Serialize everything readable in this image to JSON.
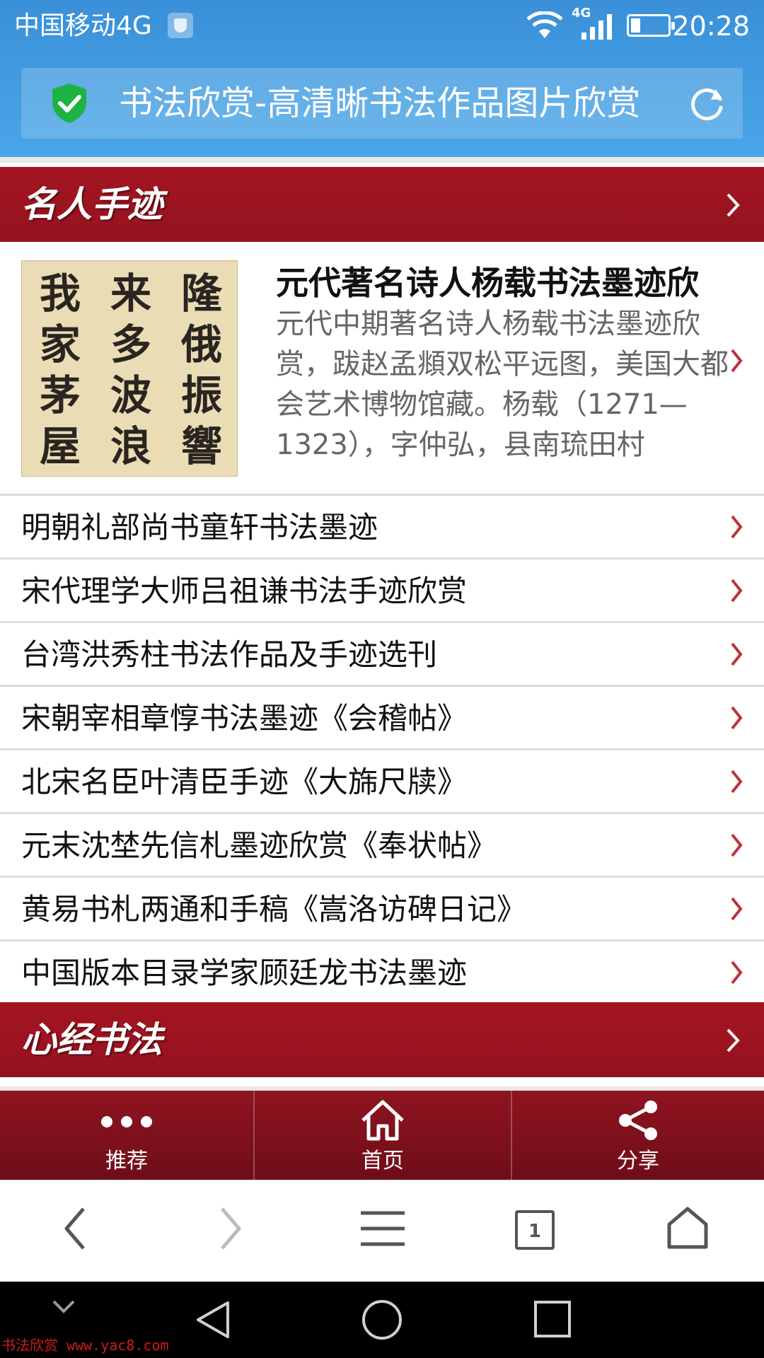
{
  "status_bar": {
    "carrier": "中国移动4G",
    "network_type": "4G",
    "time": "20:28",
    "battery_level": 0.25
  },
  "address_bar": {
    "title": "书法欣赏-高清晰书法作品图片欣赏"
  },
  "sections": [
    {
      "title": "名人手迹"
    },
    {
      "title": "心经书法"
    }
  ],
  "featured": {
    "title": "元代著名诗人杨载书法墨迹欣",
    "description": "元代中期著名诗人杨载书法墨迹欣赏，跋赵孟頫双松平远图，美国大都会艺术博物馆藏。杨载（1271—1323），字仲弘，县南琉田村",
    "thumbnail_columns": [
      "隆俄振響",
      "来多波浪",
      "我家茅屋"
    ]
  },
  "articles": [
    {
      "label": "明朝礼部尚书童轩书法墨迹"
    },
    {
      "label": "宋代理学大师吕祖谦书法手迹欣赏"
    },
    {
      "label": "台湾洪秀柱书法作品及手迹选刊"
    },
    {
      "label": "宋朝宰相章惇书法墨迹《会稽帖》"
    },
    {
      "label": "北宋名臣叶清臣手迹《大旆尺牍》"
    },
    {
      "label": "元末沈埜先信札墨迹欣赏《奉状帖》"
    },
    {
      "label": "黄易书札两通和手稿《嵩洛访碑日记》"
    },
    {
      "label": "中国版本目录学家顾廷龙书法墨迹"
    }
  ],
  "site_nav": [
    {
      "label": "推荐",
      "icon": "more-dots-icon"
    },
    {
      "label": "首页",
      "icon": "home-icon"
    },
    {
      "label": "分享",
      "icon": "share-icon"
    }
  ],
  "browser_toolbar": {
    "tab_count": "1",
    "icons": [
      "back-icon",
      "forward-icon",
      "menu-icon",
      "tabs-icon",
      "home-icon"
    ]
  },
  "watermark": "书法欣赏 www.yac8.com",
  "colors": {
    "header_blue": "#3a90d8",
    "section_red": "#a31521",
    "nav_dark_red": "#7a0f1a",
    "chevron_red": "#c0303a",
    "shield_green": "#1db343"
  }
}
